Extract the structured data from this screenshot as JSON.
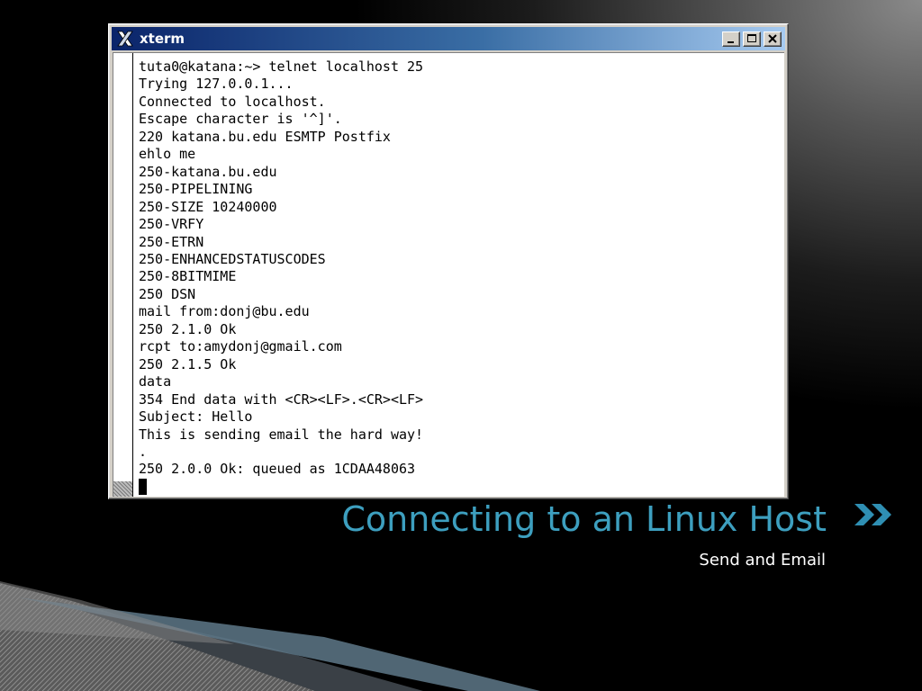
{
  "window": {
    "title": "xterm",
    "app_icon": "x-window-icon",
    "controls": [
      "minimize-icon",
      "maximize-icon",
      "close-icon"
    ]
  },
  "terminal": {
    "lines": [
      "tuta0@katana:~> telnet localhost 25",
      "Trying 127.0.0.1...",
      "Connected to localhost.",
      "Escape character is '^]'.",
      "220 katana.bu.edu ESMTP Postfix",
      "ehlo me",
      "250-katana.bu.edu",
      "250-PIPELINING",
      "250-SIZE 10240000",
      "250-VRFY",
      "250-ETRN",
      "250-ENHANCEDSTATUSCODES",
      "250-8BITMIME",
      "250 DSN",
      "mail from:donj@bu.edu",
      "250 2.1.0 Ok",
      "rcpt to:amydonj@gmail.com",
      "250 2.1.5 Ok",
      "data",
      "354 End data with <CR><LF>.<CR><LF>",
      "Subject: Hello",
      "This is sending email the hard way!",
      ".",
      "250 2.0.0 Ok: queued as 1CDAA48063"
    ]
  },
  "slide": {
    "title": "Connecting to an Linux Host",
    "subtitle": "Send and Email",
    "nav_icon": "double-chevron-right-icon"
  },
  "colors": {
    "title": "#3d9fbf",
    "accent": "#2f8fb3",
    "titlebar_start": "#0a246a",
    "titlebar_end": "#a6caf0"
  }
}
